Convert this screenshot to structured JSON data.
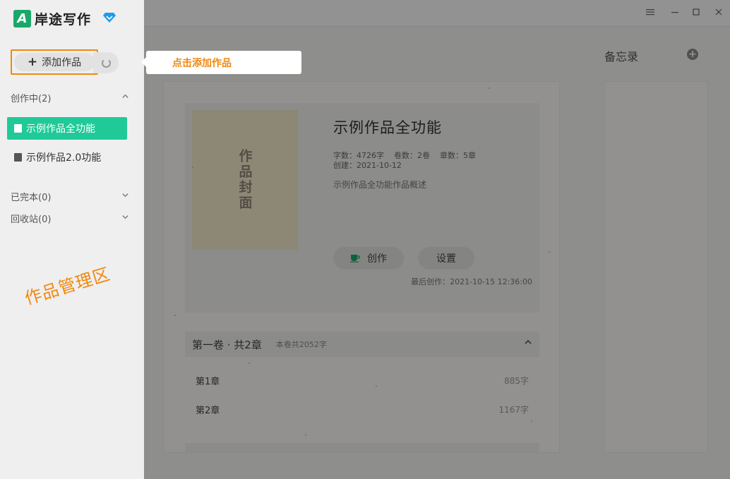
{
  "window": {
    "menu_icon": "menu-icon",
    "minimize_icon": "minimize-icon",
    "maximize_icon": "maximize-icon",
    "close_icon": "close-icon"
  },
  "sidebar": {
    "app_name": "岸途写作",
    "logo_letter": "A",
    "vip_icon": "diamond-icon",
    "add_button_label": "添加作品",
    "groups": [
      {
        "label": "创作中(2)",
        "expanded": true
      },
      {
        "label": "已完本(0)",
        "expanded": false
      },
      {
        "label": "回收站(0)",
        "expanded": false
      }
    ],
    "works": [
      {
        "title": "示例作品全功能",
        "active": true
      },
      {
        "title": "示例作品2.0功能",
        "active": false
      }
    ],
    "annotation": "作品管理区"
  },
  "tooltip": {
    "text": "点击添加作品"
  },
  "main": {
    "memo_title": "备忘录",
    "book": {
      "cover_text": "作品封面",
      "title": "示例作品全功能",
      "word_count": "字数：4726字",
      "volume_count": "卷数：2卷",
      "chapter_count": "章数：5章",
      "created": "创建：2021-10-12",
      "description": "示例作品全功能作品概述",
      "write_label": "创作",
      "settings_label": "设置",
      "last_write": "最后创作：2021-10-15 12:36:00"
    },
    "volumes": [
      {
        "name": "第一卷 · 共2章",
        "count": "本卷共2052字",
        "chapters": [
          {
            "name": "第1章",
            "words": "885字"
          },
          {
            "name": "第2章",
            "words": "1167字"
          }
        ]
      }
    ]
  },
  "colors": {
    "accent_green": "#1fca98",
    "annotation_orange": "#f0880f",
    "logo_green": "#1aa86a",
    "cover_bg": "#f3e8cb"
  }
}
